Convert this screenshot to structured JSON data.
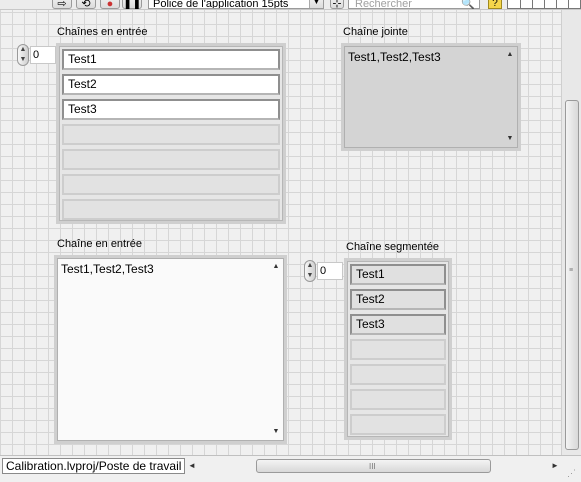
{
  "toolbar": {
    "font_select": "Police de l'application 15pts",
    "search_placeholder": "Rechercher",
    "help": "?"
  },
  "controls": {
    "input_array": {
      "label": "Chaînes en entrée",
      "index": "0",
      "cells": [
        "Test1",
        "Test2",
        "Test3",
        "",
        "",
        "",
        ""
      ]
    },
    "joined_string": {
      "label": "Chaîne jointe",
      "value": "Test1,Test2,Test3"
    },
    "input_string": {
      "label": "Chaîne en entrée",
      "value": "Test1,Test2,Test3"
    },
    "segmented_array": {
      "label": "Chaîne segmentée",
      "index": "0",
      "cells": [
        "Test1",
        "Test2",
        "Test3",
        "",
        "",
        "",
        ""
      ]
    }
  },
  "statusbar": {
    "context": "Calibration.lvproj/Poste de travail"
  },
  "icons": {
    "up": "▲",
    "down": "▼",
    "left": "◄",
    "right": "►",
    "grip": "≡"
  }
}
